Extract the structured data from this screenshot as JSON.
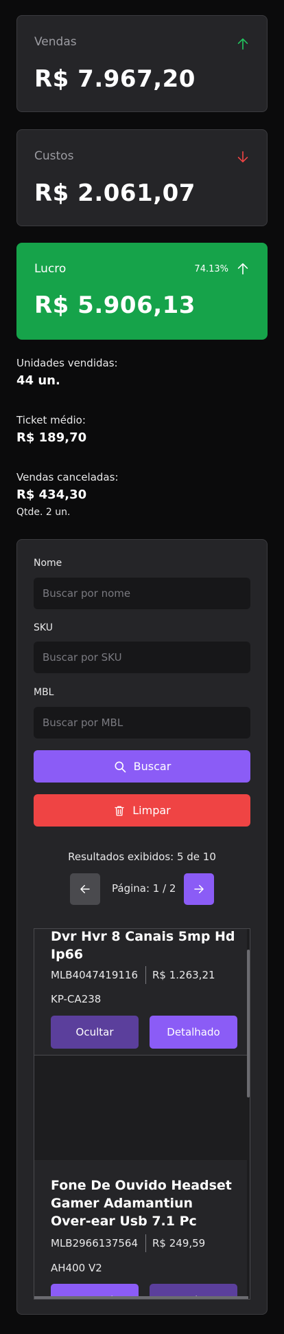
{
  "summary": {
    "sales": {
      "label": "Vendas",
      "value": "R$ 7.967,20",
      "trend": "up",
      "trend_color": "#22c55e"
    },
    "costs": {
      "label": "Custos",
      "value": "R$ 2.061,07",
      "trend": "down",
      "trend_color": "#ef4444"
    },
    "profit": {
      "label": "Lucro",
      "value": "R$ 5.906,13",
      "percent": "74.13%",
      "trend": "up",
      "bg_color": "#16a34a"
    }
  },
  "stats": {
    "units": {
      "label": "Unidades vendidas:",
      "value": "44 un."
    },
    "ticket": {
      "label": "Ticket médio:",
      "value": "R$ 189,70"
    },
    "cancelled": {
      "label": "Vendas canceladas:",
      "value": "R$ 434,30",
      "qty": "Qtde. 2 un."
    }
  },
  "filters": {
    "name": {
      "label": "Nome",
      "placeholder": "Buscar por nome",
      "value": ""
    },
    "sku": {
      "label": "SKU",
      "placeholder": "Buscar por SKU",
      "value": ""
    },
    "mbl": {
      "label": "MBL",
      "placeholder": "Buscar por MBL",
      "value": ""
    },
    "search_label": "Buscar",
    "clear_label": "Limpar"
  },
  "results": {
    "summary": "Resultados exibidos: 5 de 10",
    "page_text": "Página: 1 / 2"
  },
  "products": [
    {
      "title": "Dvr Hvr 8 Canais 5mp Hd Ip66",
      "mlb": "MLB4047419116",
      "price": "R$ 1.263,21",
      "sku": "KP-CA238",
      "btn_left": "Ocultar",
      "btn_right": "Detalhado"
    },
    {
      "title": "Fone De Ouvido Headset Gamer Adamantiun Over-ear Usb 7.1 Pc",
      "mlb": "MLB2966137564",
      "price": "R$ 249,59",
      "sku": "AH400 V2",
      "btn_left": "Agrupado",
      "btn_right": "Ocultar"
    }
  ],
  "colors": {
    "accent": "#8b5cf6",
    "accent_dark": "#5b3f9c",
    "danger": "#ef4444",
    "success": "#16a34a"
  },
  "icons": [
    "arrow-up-icon",
    "arrow-down-icon",
    "search-icon",
    "trash-icon",
    "arrow-left-icon",
    "arrow-right-icon"
  ]
}
